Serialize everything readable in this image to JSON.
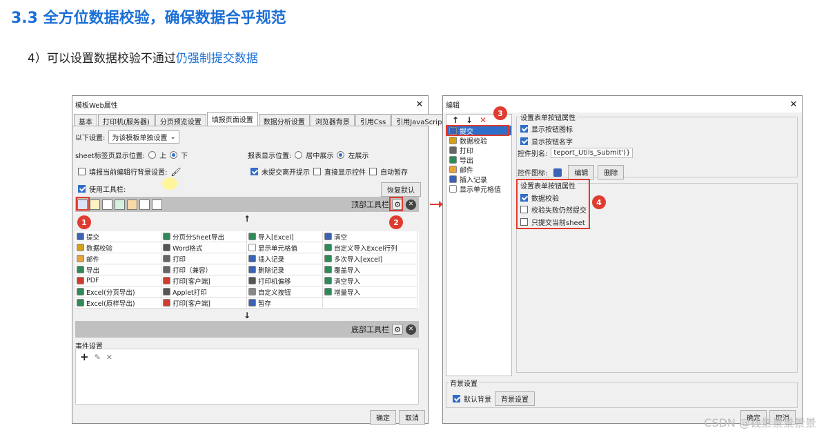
{
  "heading": "3.3 全方位数据校验，确保数据合乎规范",
  "subline": {
    "prefix": "4）可以设置数据校验不通过",
    "highlight": "仍强制提交数据"
  },
  "left_dialog": {
    "title": "模板Web属性",
    "tabs": [
      "基本",
      "打印机(服务器)",
      "分页预览设置",
      "填报页面设置",
      "数据分析设置",
      "浏览器背景",
      "引用Css",
      "引用JavaScript"
    ],
    "active_tab": "填报页面设置",
    "setting_label": "以下设置:",
    "setting_value": "为该模板单独设置",
    "sheet_pos_label": "sheet标签页显示位置:",
    "sheet_pos_options": [
      "上",
      "下"
    ],
    "report_pos_label": "报表显示位置:",
    "report_pos_options": [
      "居中展示",
      "左展示"
    ],
    "fill_bg_label": "填报当前编辑行背景设置:",
    "unsubmit_tip": "未提交离开提示",
    "direct_show": "直接显示控件",
    "auto_save": "自动暂存",
    "use_toolbar": "使用工具栏:",
    "restore_default": "恢复默认",
    "top_toolbar_label": "顶部工具栏",
    "bottom_toolbar_label": "底部工具栏",
    "up_arrow": "↑",
    "down_arrow": "↓",
    "grid_items": [
      {
        "label": "提交",
        "color": "#3a62b5"
      },
      {
        "label": "分页分Sheet导出",
        "color": "#2e8b57"
      },
      {
        "label": "导入[Excel]",
        "color": "#2e8b57"
      },
      {
        "label": "清空",
        "color": "#3a62b5"
      },
      {
        "label": "数据校验",
        "color": "#d4a017"
      },
      {
        "label": "Word格式",
        "color": "#555"
      },
      {
        "label": "显示单元格值",
        "color": "#ffffff"
      },
      {
        "label": "自定义导入Excel行列",
        "color": "#2e8b57"
      },
      {
        "label": "邮件",
        "color": "#e8a33c"
      },
      {
        "label": "打印",
        "color": "#666"
      },
      {
        "label": "插入记录",
        "color": "#3a62b5"
      },
      {
        "label": "多次导入[excel]",
        "color": "#2e8b57"
      },
      {
        "label": "导出",
        "color": "#2e8b57"
      },
      {
        "label": "打印（兼容）",
        "color": "#666"
      },
      {
        "label": "删除记录",
        "color": "#3a62b5"
      },
      {
        "label": "覆盖导入",
        "color": "#2e8b57"
      },
      {
        "label": "PDF",
        "color": "#d23b2c"
      },
      {
        "label": "打印[客户端]",
        "color": "#d23b2c"
      },
      {
        "label": "打印机偏移",
        "color": "#555"
      },
      {
        "label": "清空导入",
        "color": "#2e8b57"
      },
      {
        "label": "Excel(分页导出)",
        "color": "#2e8b57"
      },
      {
        "label": "Applet打印",
        "color": "#555"
      },
      {
        "label": "自定义按钮",
        "color": "#888"
      },
      {
        "label": "增量导入",
        "color": "#2e8b57"
      },
      {
        "label": "Excel(原样导出)",
        "color": "#2e8b57"
      },
      {
        "label": "打印[客户端]",
        "color": "#d23b2c"
      },
      {
        "label": "暂存",
        "color": "#3a62b5"
      },
      {
        "label": "",
        "color": ""
      }
    ],
    "event_label": "事件设置",
    "event_add": "+",
    "event_edit": "✎",
    "event_delete": "✕",
    "ok": "确定",
    "cancel": "取消",
    "badge1": "1",
    "badge2": "2"
  },
  "right_dialog": {
    "title": "编辑",
    "toolbar": {
      "up": "↑",
      "down": "↓",
      "delete": "✕"
    },
    "list_items": [
      {
        "label": "提交",
        "color": "#3a62b5"
      },
      {
        "label": "数据校验",
        "color": "#d4a017"
      },
      {
        "label": "打印",
        "color": "#666"
      },
      {
        "label": "导出",
        "color": "#2e8b57"
      },
      {
        "label": "邮件",
        "color": "#e8a33c"
      },
      {
        "label": "插入记录",
        "color": "#3a62b5"
      },
      {
        "label": "显示单元格值",
        "color": "#ffffff"
      }
    ],
    "selected_index": 0,
    "group1_title": "设置表单按钮属性",
    "show_icon": "显示按钮图标",
    "show_name": "显示按钮名字",
    "alias_label": "控件别名:",
    "alias_value": "teport_Utils_Submit')}",
    "icon_label": "控件图标:",
    "edit_btn": "编辑",
    "delete_btn": "删除",
    "group2_title": "设置表单按钮属性",
    "data_check": "数据校验",
    "force_submit": "校验失败仍然提交",
    "only_current": "只提交当前sheet",
    "bg_group_title": "背景设置",
    "default_bg": "默认背景",
    "bg_settings_btn": "背景设置",
    "ok": "确定",
    "cancel": "取消",
    "badge3": "3",
    "badge4": "4"
  },
  "watermark": "CSDN @钱景景景景景",
  "colors": {
    "accent": "#1a6fd6",
    "annotation": "#e03b2f",
    "selection": "#2f6ec9"
  }
}
